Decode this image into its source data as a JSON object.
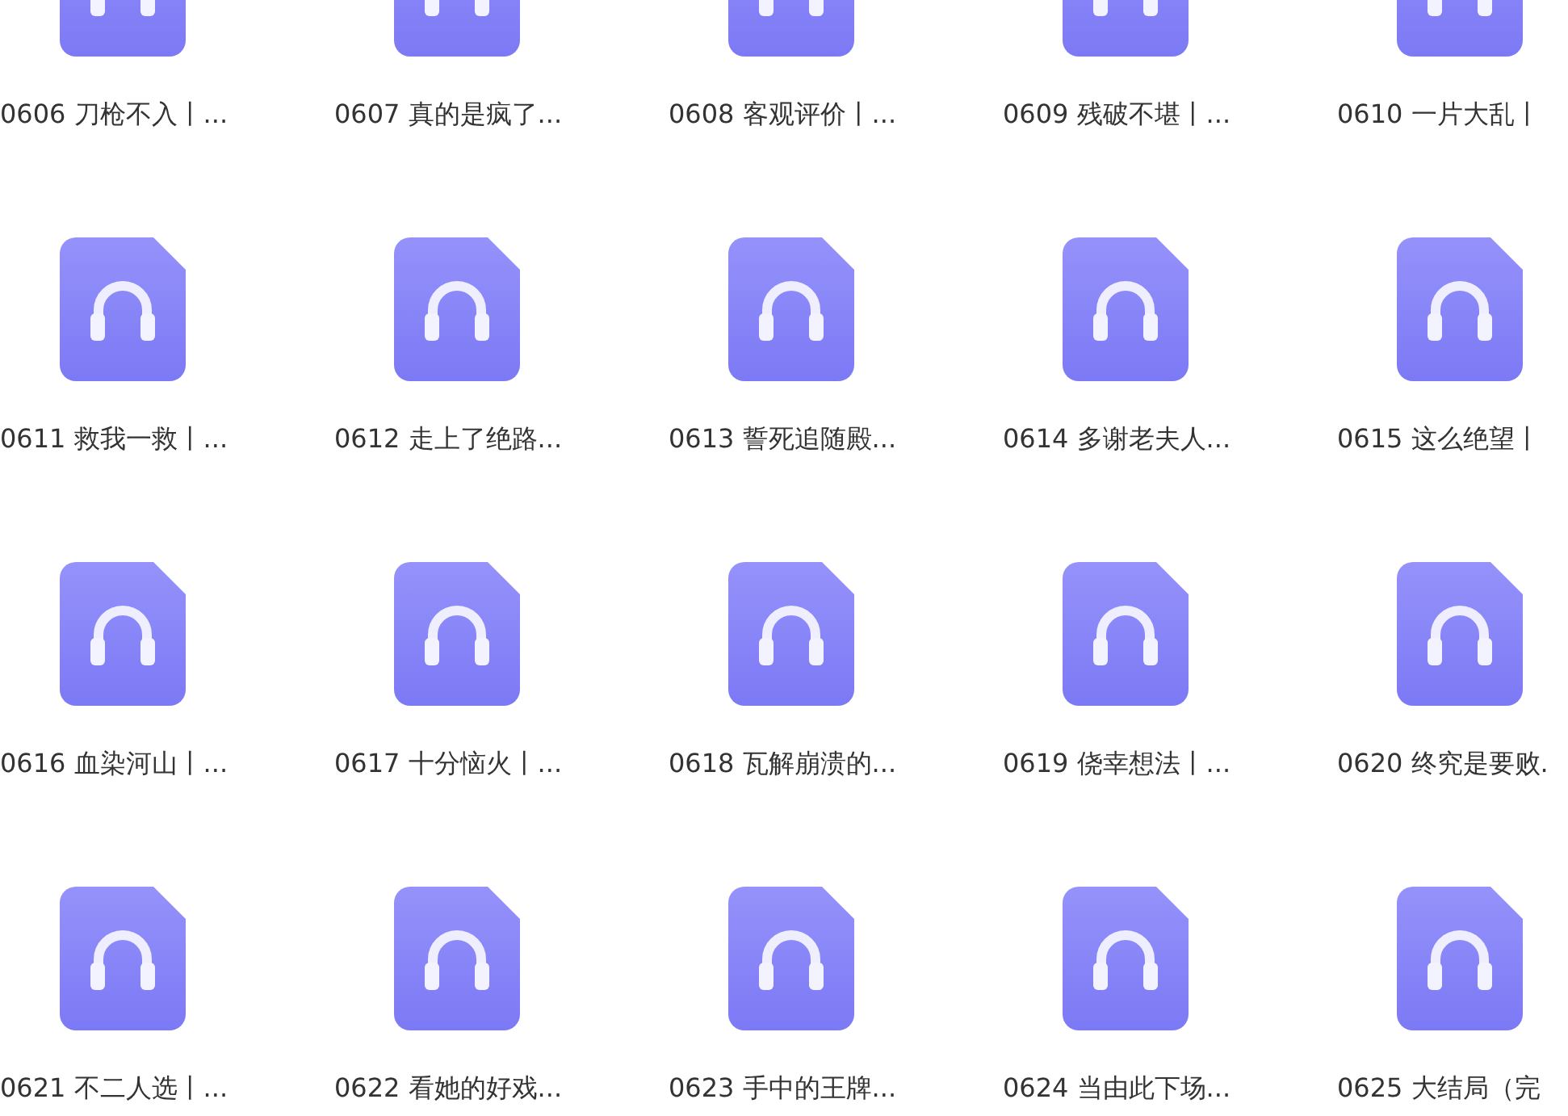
{
  "files": [
    {
      "name": "0606 刀枪不入丨..."
    },
    {
      "name": "0607 真的是疯了..."
    },
    {
      "name": "0608 客观评价丨..."
    },
    {
      "name": "0609 残破不堪丨..."
    },
    {
      "name": "0610 一片大乱丨"
    },
    {
      "name": "0611 救我一救丨..."
    },
    {
      "name": "0612 走上了绝路..."
    },
    {
      "name": "0613 誓死追随殿..."
    },
    {
      "name": "0614 多谢老夫人..."
    },
    {
      "name": "0615 这么绝望丨"
    },
    {
      "name": "0616 血染河山丨..."
    },
    {
      "name": "0617 十分恼火丨..."
    },
    {
      "name": "0618 瓦解崩溃的..."
    },
    {
      "name": "0619 侥幸想法丨..."
    },
    {
      "name": "0620 终究是要败."
    },
    {
      "name": "0621 不二人选丨..."
    },
    {
      "name": "0622 看她的好戏..."
    },
    {
      "name": "0623 手中的王牌..."
    },
    {
      "name": "0624 当由此下场..."
    },
    {
      "name": "0625 大结局（完"
    }
  ]
}
